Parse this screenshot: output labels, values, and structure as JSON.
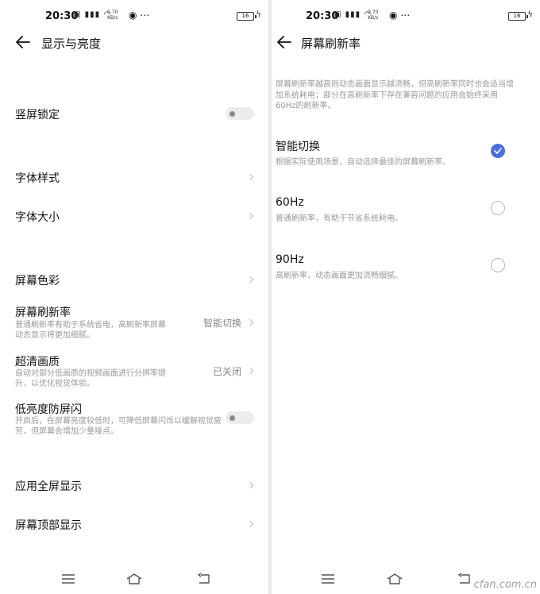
{
  "status_bar": {
    "time": "20:30",
    "speed_value": "0.70",
    "speed_unit": "KB/s",
    "battery": "16"
  },
  "left_screen": {
    "title": "显示与亮度",
    "items": {
      "portrait_lock": {
        "label": "竖屏锁定",
        "toggle_state": "off"
      },
      "font_style": {
        "label": "字体样式"
      },
      "font_size": {
        "label": "字体大小"
      },
      "screen_color": {
        "label": "屏幕色彩"
      },
      "refresh_rate": {
        "label": "屏幕刷新率",
        "desc": "普通刷新率有助于系统省电，高刷新率屏幕动态显示将更加细腻。",
        "value": "智能切换"
      },
      "hd_quality": {
        "label": "超清画质",
        "desc": "自动对部分低画质的视频画面进行分辨率提升，以优化视觉体验。",
        "value": "已关闭"
      },
      "anti_flicker": {
        "label": "低亮度防屏闪",
        "desc": "开启后，在屏幕亮度较低时，可降低屏幕闪烁以缓解视觉疲劳，但屏幕会增加少量噪点。",
        "toggle_state": "off"
      },
      "full_screen_apps": {
        "label": "应用全屏显示"
      },
      "top_display": {
        "label": "屏幕顶部显示"
      }
    }
  },
  "right_screen": {
    "title": "屏幕刷新率",
    "intro": "屏幕刷新率越高则动态画面显示越流畅，但高刷新率同时也会适当增加系统耗电；部分在高刷新率下存在兼容问题的应用会始终采用60Hz的刷新率。",
    "options": [
      {
        "label": "智能切换",
        "desc": "根据实际使用场景，自动选择最佳的屏幕刷新率。",
        "selected": true
      },
      {
        "label": "60Hz",
        "desc": "普通刷新率，有助于节省系统耗电。",
        "selected": false
      },
      {
        "label": "90Hz",
        "desc": "高刷新率，动态画面更加流畅细腻。",
        "selected": false
      }
    ]
  },
  "watermark": "cfan.com.cn",
  "colors": {
    "accent": "#4a6fe3",
    "secondary_text": "#999999"
  }
}
